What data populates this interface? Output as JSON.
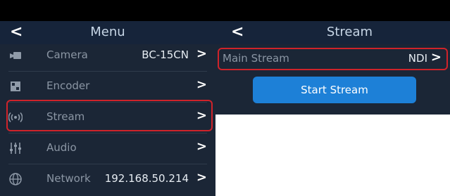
{
  "menu_screen": {
    "title": "Menu",
    "back_label": "<",
    "items": [
      {
        "label": "Camera",
        "value": "BC-15CN",
        "icon": "camera-icon",
        "chevron": ">"
      },
      {
        "label": "Encoder",
        "value": "",
        "icon": "encoder-icon",
        "chevron": ">"
      },
      {
        "label": "Stream",
        "value": "",
        "icon": "stream-icon",
        "chevron": ">",
        "highlighted": true
      },
      {
        "label": "Audio",
        "value": "",
        "icon": "audio-mixer-icon",
        "chevron": ">"
      },
      {
        "label": "Network",
        "value": "192.168.50.214",
        "icon": "globe-icon",
        "chevron": ">"
      }
    ]
  },
  "stream_screen": {
    "title": "Stream",
    "back_label": "<",
    "main_stream": {
      "label": "Main Stream",
      "value": "NDI",
      "chevron": ">",
      "highlighted": true
    },
    "start_button_label": "Start Stream"
  },
  "colors": {
    "panel_bg": "#1b2636",
    "header_bg": "#16243a",
    "highlight": "#d0232a",
    "accent_button": "#1d80d7"
  }
}
